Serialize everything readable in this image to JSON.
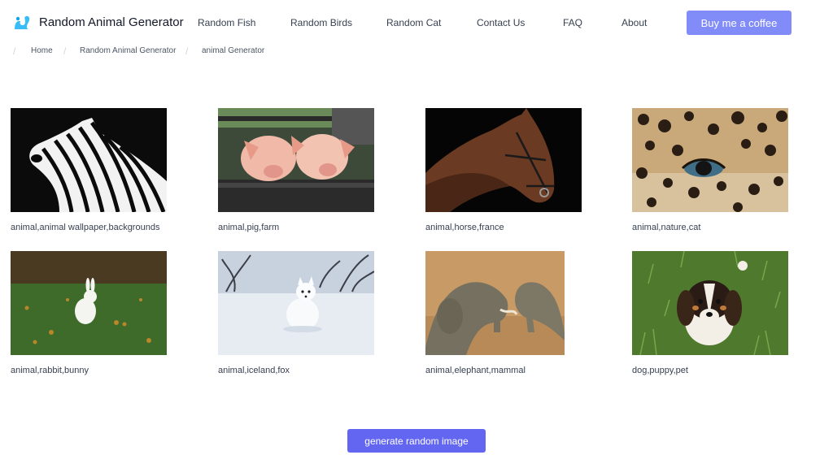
{
  "header": {
    "brand": "Random Animal Generator",
    "nav": [
      "Random Fish",
      "Random Birds",
      "Random Cat",
      "Contact Us",
      "FAQ",
      "About"
    ],
    "coffee_label": "Buy me a coffee"
  },
  "breadcrumb": [
    "Home",
    "Random Animal Generator",
    "animal Generator"
  ],
  "images": [
    {
      "caption": "animal,animal wallpaper,backgrounds",
      "subject": "zebra"
    },
    {
      "caption": "animal,pig,farm",
      "subject": "pigs"
    },
    {
      "caption": "animal,horse,france",
      "subject": "horse"
    },
    {
      "caption": "animal,nature,cat",
      "subject": "leopard"
    },
    {
      "caption": "animal,rabbit,bunny",
      "subject": "rabbit"
    },
    {
      "caption": "animal,iceland,fox",
      "subject": "arctic fox"
    },
    {
      "caption": "animal,elephant,mammal",
      "subject": "elephants"
    },
    {
      "caption": "dog,puppy,pet",
      "subject": "puppy"
    }
  ],
  "generate_label": "generate random image",
  "colors": {
    "accent": "#6366f1",
    "accent_light": "#818cf8"
  }
}
